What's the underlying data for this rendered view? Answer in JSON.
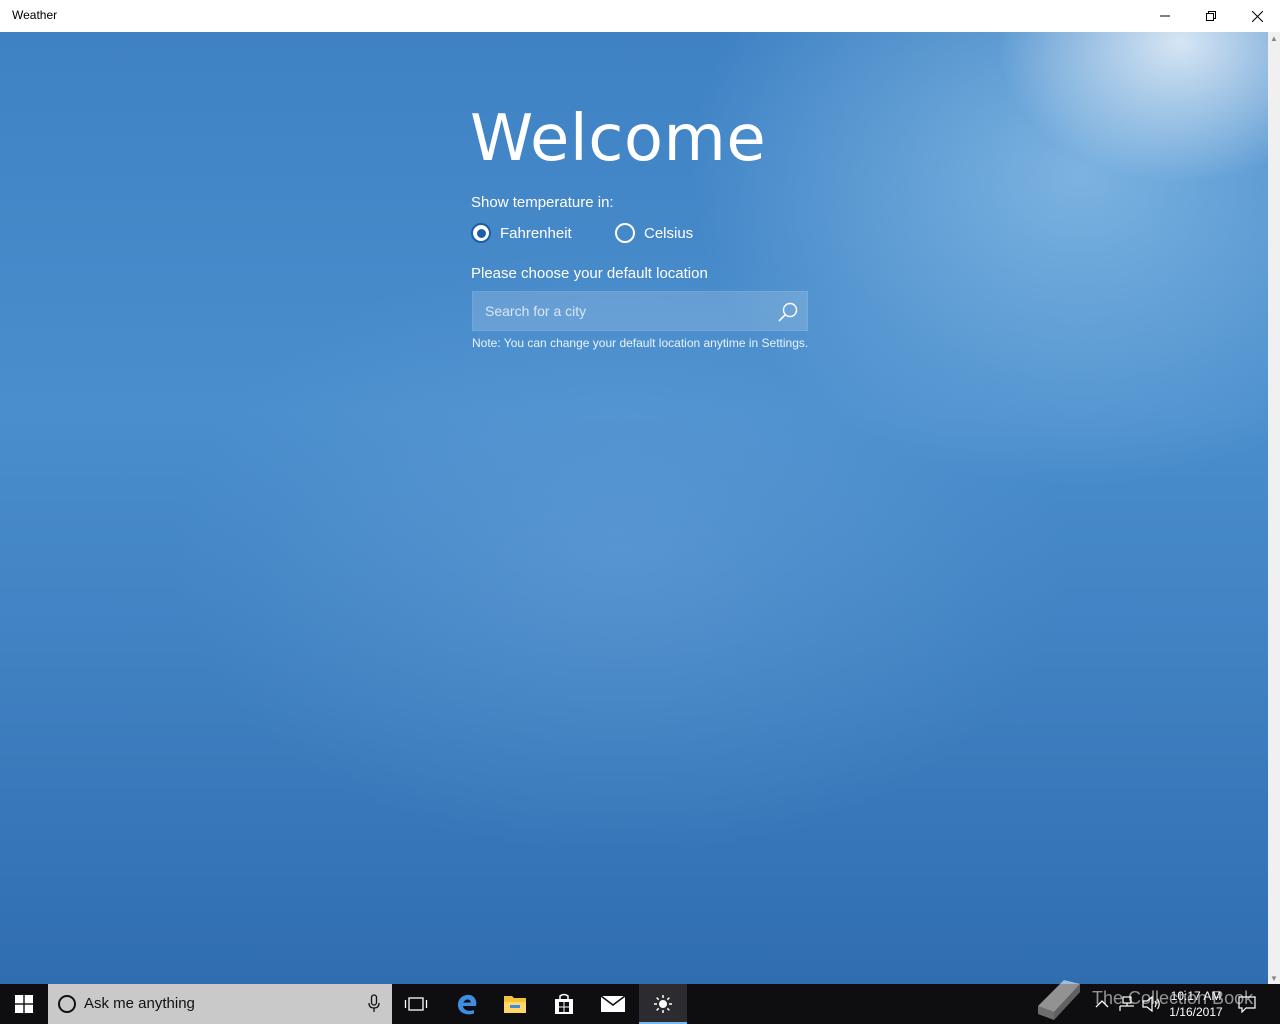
{
  "window": {
    "title": "Weather",
    "controls": {
      "minimize": "minimize",
      "restore": "restore",
      "close": "close"
    }
  },
  "welcome": {
    "heading": "Welcome",
    "temperature_label": "Show temperature in:",
    "units": [
      {
        "label": "Fahrenheit",
        "selected": true
      },
      {
        "label": "Celsius",
        "selected": false
      }
    ],
    "location_label": "Please choose your default location",
    "search_placeholder": "Search for a city",
    "search_value": "",
    "note": "Note: You can change your default location anytime in Settings."
  },
  "taskbar": {
    "search_text": "Ask me anything",
    "pinned": [
      "task-view-icon",
      "edge-icon",
      "file-explorer-icon",
      "store-icon",
      "mail-icon",
      "weather-icon"
    ],
    "active_app": "Weather",
    "clock": {
      "time": "10:17 AM",
      "date": "1/16/2017"
    }
  },
  "watermark": {
    "text": "The Collection Book"
  },
  "colors": {
    "background_top": "#3f82c4",
    "background_bottom": "#2f6db0",
    "radio_selected": "#1a5fa8",
    "taskbar": "#0e0e10",
    "search_bar": "#c9c9c9"
  }
}
